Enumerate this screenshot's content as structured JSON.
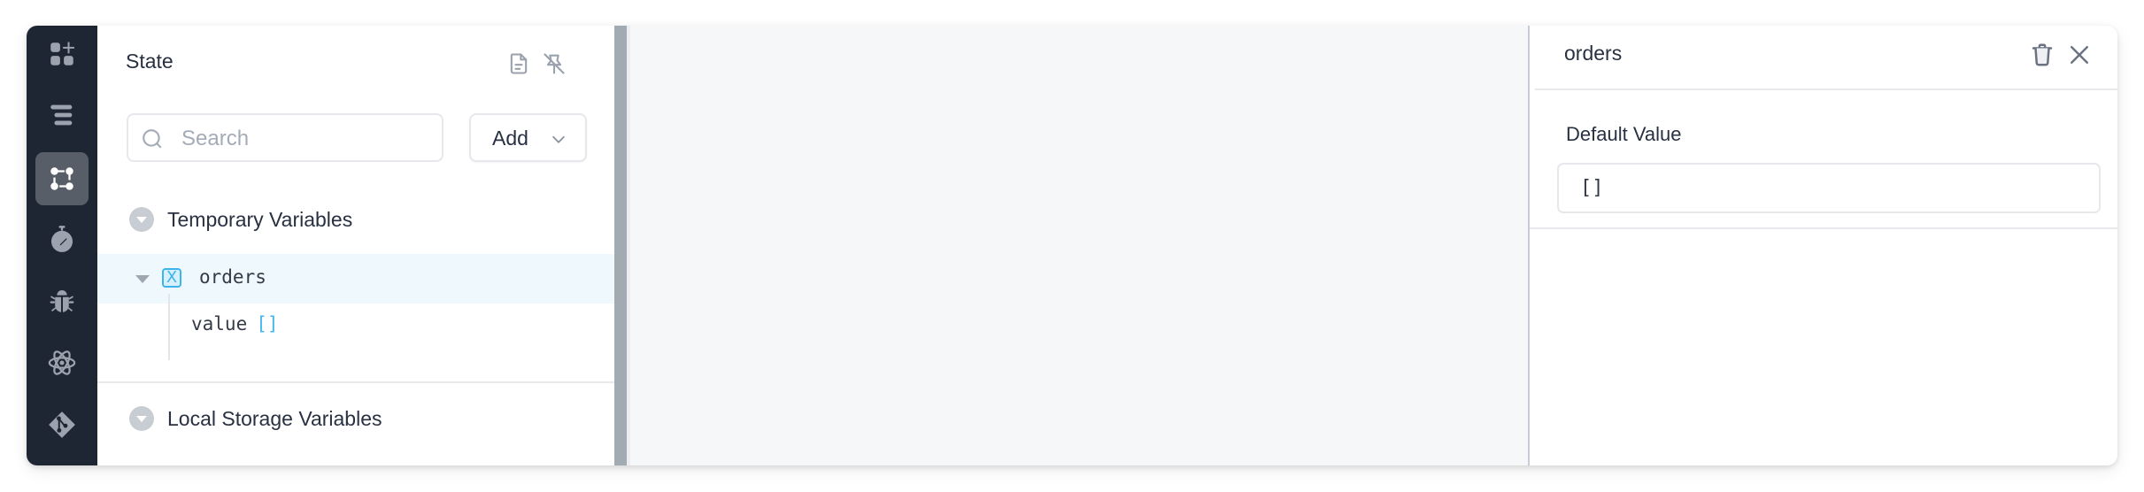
{
  "rail": {
    "items": [
      {
        "name": "add-widget",
        "icon": "add-widget-icon",
        "active": false
      },
      {
        "name": "outline",
        "icon": "outline-list-icon",
        "active": false
      },
      {
        "name": "state",
        "icon": "state-graph-icon",
        "active": true
      },
      {
        "name": "performance",
        "icon": "stopwatch-icon",
        "active": false
      },
      {
        "name": "debug",
        "icon": "bug-icon",
        "active": false
      },
      {
        "name": "react",
        "icon": "atom-icon",
        "active": false
      },
      {
        "name": "git",
        "icon": "git-icon",
        "active": false
      }
    ]
  },
  "state_panel": {
    "title": "State",
    "header_icons": [
      "document-icon",
      "pin-off-icon"
    ],
    "search": {
      "placeholder": "Search",
      "value": ""
    },
    "add_button": {
      "label": "Add"
    },
    "sections": [
      {
        "label": "Temporary Variables",
        "expanded": true,
        "variables": [
          {
            "name": "orders",
            "badge": "X",
            "expanded": true,
            "selected": true,
            "fields": [
              {
                "key": "value",
                "value": "[]"
              }
            ]
          }
        ]
      },
      {
        "label": "Local Storage Variables",
        "expanded": true,
        "variables": []
      }
    ]
  },
  "inspector": {
    "title": "orders",
    "field_label": "Default Value",
    "default_value": "[]"
  },
  "colors": {
    "rail_bg": "#1f2633",
    "rail_active": "#585e68",
    "selected_row": "#eef8fd",
    "accent_blue": "#3db4ee",
    "splitter": "#a2abb1",
    "text_primary": "#283042"
  }
}
